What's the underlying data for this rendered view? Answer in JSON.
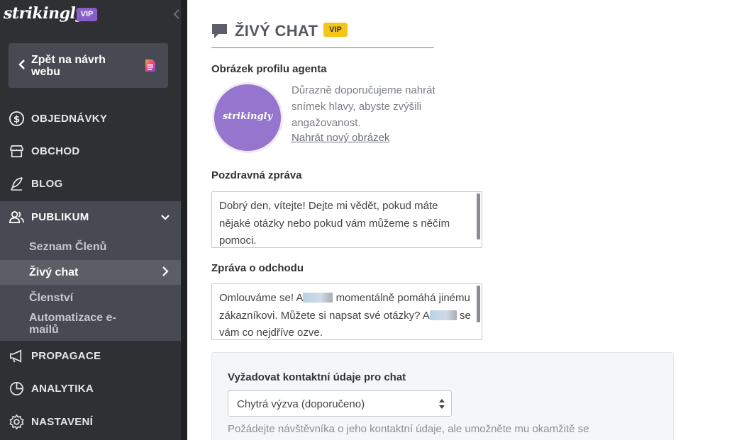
{
  "sidebar": {
    "logo": "strikingly",
    "vip_badge": "VIP",
    "back_button": "Zpět na návrh webu",
    "nav": [
      {
        "id": "orders",
        "label": "OBJEDNÁVKY",
        "icon": "dollar-circle-icon"
      },
      {
        "id": "store",
        "label": "OBCHOD",
        "icon": "storefront-icon"
      },
      {
        "id": "blog",
        "label": "BLOG",
        "icon": "feather-pen-icon"
      },
      {
        "id": "audience",
        "label": "PUBLIKUM",
        "icon": "users-icon"
      },
      {
        "id": "promotion",
        "label": "PROPAGACE",
        "icon": "megaphone-icon"
      },
      {
        "id": "analytics",
        "label": "ANALYTIKA",
        "icon": "pie-chart-icon"
      },
      {
        "id": "settings",
        "label": "NASTAVENÍ",
        "icon": "gear-icon"
      }
    ],
    "audience_sub": [
      {
        "label": "Seznam Členů"
      },
      {
        "label": "Živý chat"
      },
      {
        "label": "Členství"
      },
      {
        "label": "Automatizace e-mailů"
      }
    ]
  },
  "main": {
    "title": "ŽIVÝ CHAT",
    "title_badge": "VIP",
    "avatar_section": {
      "label": "Obrázek profilu agenta",
      "avatar_text": "strikingly",
      "hint": "Důrazně doporučujeme nahrát snímek hlavy, abyste zvýšili angažovanost.",
      "upload_link": "Nahrát nový obrázek"
    },
    "greeting": {
      "label": "Pozdravná zpráva",
      "value": "Dobrý den, vítejte! Dejte mi vědět, pokud máte nějaké otázky nebo pokud vám můžeme s něčím pomoci."
    },
    "away": {
      "label": "Zpráva o odchodu",
      "part1": "Omlouváme se! A",
      "part2": "momentálně pomáhá jinému zákazníkovi. Můžete si napsat své otázky? A",
      "part3": "se vám co nejdříve ozve."
    },
    "contact": {
      "label": "Vyžadovat kontaktní údaje pro chat",
      "selected": "Chytrá výzva (doporučeno)",
      "hint": "Požádejte návštěvníka o jeho kontaktní údaje, ale umožněte mu okamžitě se"
    }
  },
  "colors": {
    "sidebar_bg": "#2f3033",
    "sidebar_active": "#474a52",
    "vip_purple": "#8a5ec9",
    "vip_yellow": "#f5c518",
    "accent_blue": "#3d8fd1"
  }
}
